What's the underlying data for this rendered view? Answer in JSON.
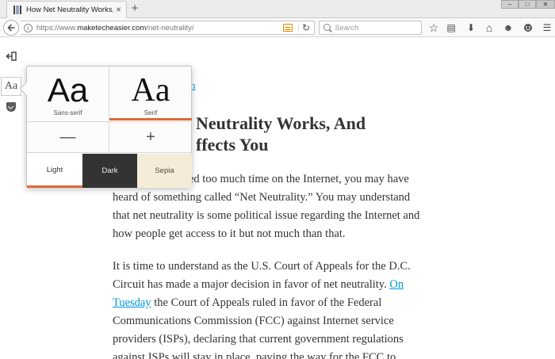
{
  "tab": {
    "title": "How Net Neutrality Works,...",
    "close": "×"
  },
  "newtab": "+",
  "window_controls": {
    "minimize": "–",
    "maximize": "□",
    "close": "✕"
  },
  "navbar": {
    "url_host": "https://www.",
    "url_domain": "maketecheasier.com",
    "url_path": "/net-neutrality/",
    "info": "i",
    "reload": "↻",
    "search_placeholder": "Search"
  },
  "toolbar_icons": {
    "bookmark": "☆",
    "reading_list": "▤",
    "download": "⬇",
    "home": "⌂",
    "chat": "☻",
    "menu": "☰"
  },
  "reader_sidebar": {
    "type_label": "Aa"
  },
  "popup": {
    "sans_sample": "Aa",
    "sans_label": "Sans-serif",
    "serif_sample": "Aa",
    "serif_label": "Serif",
    "minus": "—",
    "plus": "+",
    "themes": {
      "light": "Light",
      "dark": "Dark",
      "sepia": "Sepia"
    }
  },
  "article": {
    "domain": "om",
    "title_line1": "Neutrality Works, And",
    "title_line2": "ffects You",
    "p1": "ed too much time on the Internet, you may have heard of something called “Net Neutrality.” You may understand that net neutrality is some political issue regarding the Internet and how people get access to it but not much than that.",
    "p2_before": "It is time to understand as the U.S. Court of Appeals for the D.C. Circuit has made a major decision in favor of net neutrality. ",
    "p2_link": "On Tuesday",
    "p2_after": " the Court of Appeals ruled in favor of the Federal Communications Commission (FCC) against Internet service providers (ISPs), declaring that current government regulations against ISPs will stay in place, paving the way for the FCC to"
  }
}
